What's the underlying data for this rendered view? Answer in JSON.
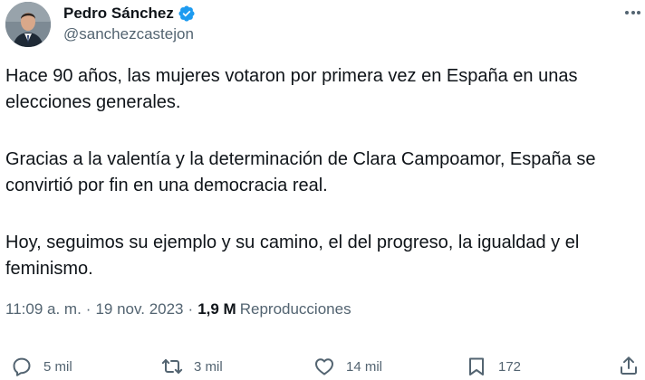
{
  "author": {
    "display_name": "Pedro Sánchez",
    "handle": "@sanchezcastejon",
    "verified": true,
    "verified_color": "#1d9bf0"
  },
  "tweet": {
    "paragraphs": [
      "Hace 90 años, las mujeres votaron por primera vez en España en unas elecciones generales.",
      "Gracias a la valentía y la determinación de Clara Campoamor, España se convirtió por fin en una democracia real.",
      "Hoy, seguimos su ejemplo y su camino, el del progreso, la igualdad y el feminismo."
    ]
  },
  "meta": {
    "time": "11:09 a. m.",
    "separator": "·",
    "date": "19 nov. 2023",
    "views_count": "1,9 M",
    "views_label": "Reproducciones"
  },
  "actions": {
    "replies": "5 mil",
    "retweets": "3 mil",
    "likes": "14 mil",
    "bookmarks": "172"
  },
  "icons": {
    "reply": "reply-icon",
    "retweet": "retweet-icon",
    "like": "heart-icon",
    "bookmark": "bookmark-icon",
    "share": "share-icon",
    "more": "more-options-icon"
  },
  "colors": {
    "text": "#0f1419",
    "secondary": "#536471",
    "background": "#ffffff"
  }
}
